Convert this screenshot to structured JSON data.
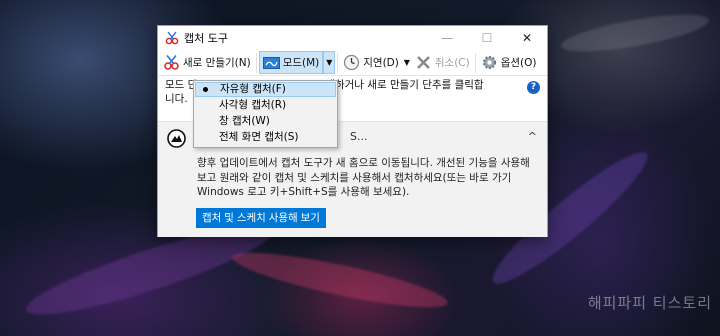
{
  "window": {
    "title": "캡처 도구",
    "controls": {
      "minimize": "—",
      "maximize": "☐",
      "close": "✕"
    }
  },
  "toolbar": {
    "new_label": "새로 만들기(N)",
    "mode_label": "모드(M)",
    "delay_label": "지연(D)",
    "cancel_label": "취소(C)",
    "options_label": "옵션(O)",
    "dropdown_arrow": "▼"
  },
  "hint": {
    "text_left": "모드 단",
    "text_right": "택하거나 새로 만들기 단추를 클릭합",
    "line2": "니다.",
    "help": "?"
  },
  "panel": {
    "heading": "S...",
    "chevron": "^",
    "body": "향후 업데이트에서 캡처 도구가 새 홈으로 이동됩니다. 개선된 기능을 사용해보고 원래와 같이 캡처 및 스케치를 사용해서 캡처하세요(또는 바로 가기 Windows 로고 키+Shift+S를 사용해 보세요).",
    "button_label": "캡처 및 스케치 사용해 보기"
  },
  "mode_menu": {
    "items": [
      {
        "label": "자유형 캡처(F)",
        "selected": true
      },
      {
        "label": "사각형 캡처(R)",
        "selected": false
      },
      {
        "label": "창 캡처(W)",
        "selected": false
      },
      {
        "label": "전체 화면 캡처(S)",
        "selected": false
      }
    ]
  },
  "watermark": "해피파피 티스토리",
  "colors": {
    "accent": "#0078d7",
    "menu_highlight": "#cce4f7",
    "help_icon": "#1b60c4"
  }
}
